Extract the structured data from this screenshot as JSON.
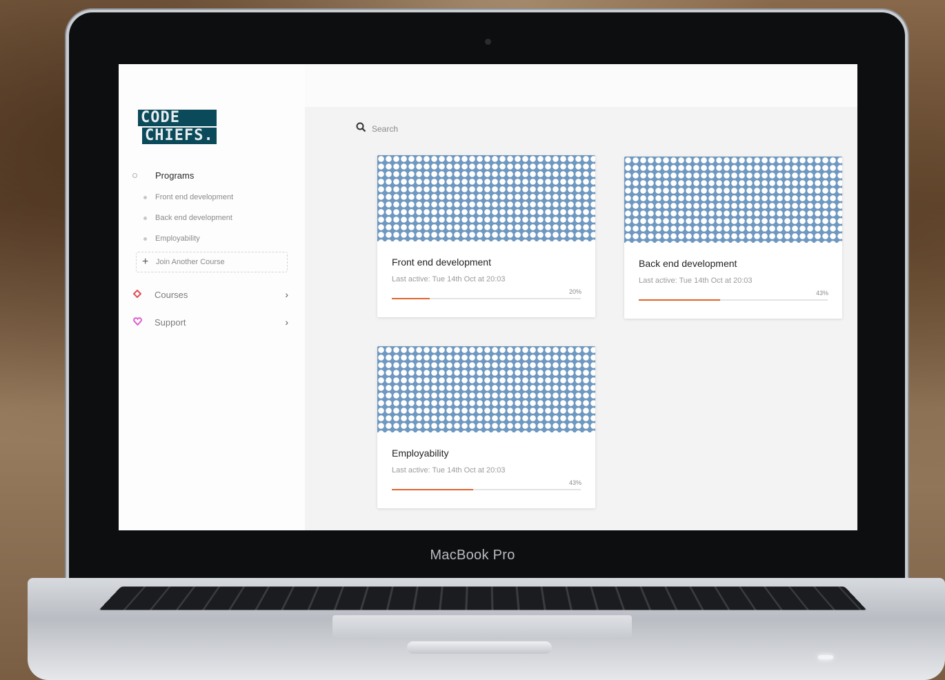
{
  "device": {
    "brand_text": "MacBook Pro"
  },
  "app": {
    "logo": {
      "line1": "CODE",
      "line2": "CHIEFS."
    },
    "sidebar": {
      "programs_label": "Programs",
      "program_items": [
        {
          "label": "Front end development"
        },
        {
          "label": "Back end development"
        },
        {
          "label": "Employability"
        }
      ],
      "join_label": "Join Another Course",
      "menu": [
        {
          "label": "Courses",
          "icon": "diamond-icon",
          "color": "#e24b55"
        },
        {
          "label": "Support",
          "icon": "heart-icon",
          "color": "#e05ad0"
        }
      ]
    },
    "search": {
      "placeholder": "Search"
    },
    "colors": {
      "accent": "#e0622a",
      "logo_bg": "#0b4a5a",
      "pattern": "#6f98c0"
    },
    "cards": [
      {
        "title": "Front end development",
        "last_active": "Last active: Tue 14th Oct at 20:03",
        "progress_label": "20%",
        "progress": 0.2
      },
      {
        "title": "Back end development",
        "last_active": "Last active: Tue 14th Oct at 20:03",
        "progress_label": "43%",
        "progress": 0.43
      },
      {
        "title": "Employability",
        "last_active": "Last active: Tue 14th Oct at 20:03",
        "progress_label": "43%",
        "progress": 0.43
      }
    ]
  }
}
